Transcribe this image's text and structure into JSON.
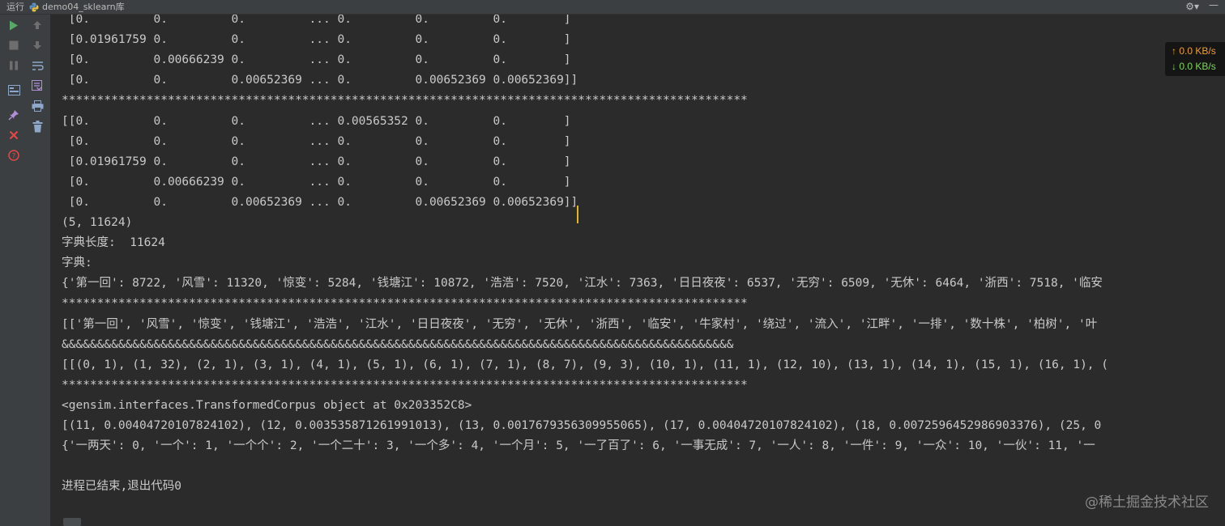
{
  "titlebar": {
    "run_label": "运行",
    "tab_label": "demo04_sklearn库"
  },
  "network_monitor": {
    "upload": "0.0 KB/s",
    "download": "0.0 KB/s"
  },
  "console": {
    "lines": [
      " [0.         0.         0.         ... 0.         0.         0.        ]",
      " [0.01961759 0.         0.         ... 0.         0.         0.        ]",
      " [0.         0.00666239 0.         ... 0.         0.         0.        ]",
      " [0.         0.         0.00652369 ... 0.         0.00652369 0.00652369]]",
      "*************************************************************************************************",
      "[[0.         0.         0.         ... 0.00565352 0.         0.        ]",
      " [0.         0.         0.         ... 0.         0.         0.        ]",
      " [0.01961759 0.         0.         ... 0.         0.         0.        ]",
      " [0.         0.00666239 0.         ... 0.         0.         0.        ]",
      " [0.         0.         0.00652369 ... 0.         0.00652369 0.00652369]]",
      "(5, 11624)",
      "字典长度:  11624",
      "字典:",
      "{'第一回': 8722, '风雪': 11320, '惊变': 5284, '钱塘江': 10872, '浩浩': 7520, '江水': 7363, '日日夜夜': 6537, '无穷': 6509, '无休': 6464, '浙西': 7518, '临安",
      "*************************************************************************************************",
      "[['第一回', '风雪', '惊变', '钱塘江', '浩浩', '江水', '日日夜夜', '无穷', '无休', '浙西', '临安', '牛家村', '绕过', '流入', '江畔', '一排', '数十株', '柏树', '叶",
      "&&&&&&&&&&&&&&&&&&&&&&&&&&&&&&&&&&&&&&&&&&&&&&&&&&&&&&&&&&&&&&&&&&&&&&&&&&&&&&&&&&&&&&&&&&&&&&&",
      "[[(0, 1), (1, 32), (2, 1), (3, 1), (4, 1), (5, 1), (6, 1), (7, 1), (8, 7), (9, 3), (10, 1), (11, 1), (12, 10), (13, 1), (14, 1), (15, 1), (16, 1), (",
      "*************************************************************************************************",
      "<gensim.interfaces.TransformedCorpus object at 0x203352C8>",
      "[(11, 0.00404720107824102), (12, 0.003535871261991013), (13, 0.0017679356309955065), (17, 0.00404720107824102), (18, 0.0072596452986903376), (25, 0",
      "{'一两天': 0, '一个': 1, '一个个': 2, '一个二十': 3, '一个多': 4, '一个月': 5, '一了百了': 6, '一事无成': 7, '一人': 8, '一件': 9, '一众': 10, '一伙': 11, '一",
      "",
      "进程已结束,退出代码0"
    ]
  },
  "watermark": "@稀土掘金技术社区"
}
